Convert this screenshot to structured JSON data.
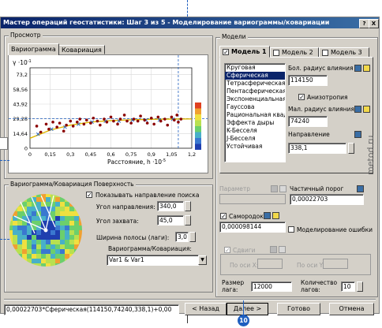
{
  "window": {
    "title": "Мастер операций геостатистики: Шаг 3 из 5 - Моделирование вариограммы/ковариации",
    "help_label": "?",
    "close_label": "X"
  },
  "preview": {
    "group_label": "Просмотр",
    "tab_variogram": "Вариограмма",
    "tab_covariance": "Ковариация",
    "y_exp": "γ ·10",
    "y_exp_sup": "-1",
    "x_label": "Расстояние, h ·10",
    "x_label_sup": "-5"
  },
  "chart_data": {
    "type": "scatter",
    "y_ticks": [
      "73,2",
      "58,56",
      "43,92",
      "29,28",
      "14,64",
      "0"
    ],
    "x_ticks": [
      "0",
      "0,15",
      "0,3",
      "0,45",
      "0,6",
      "0,75",
      "0,9",
      "1,05",
      "1,2"
    ],
    "xlim": [
      0,
      1.2
    ],
    "ylim": [
      0,
      80
    ],
    "points": [
      [
        0.05,
        22
      ],
      [
        0.08,
        16
      ],
      [
        0.12,
        24
      ],
      [
        0.14,
        19
      ],
      [
        0.17,
        26
      ],
      [
        0.2,
        21
      ],
      [
        0.22,
        25
      ],
      [
        0.25,
        17
      ],
      [
        0.27,
        23
      ],
      [
        0.3,
        27
      ],
      [
        0.32,
        22
      ],
      [
        0.35,
        26
      ],
      [
        0.37,
        29
      ],
      [
        0.4,
        24
      ],
      [
        0.42,
        28
      ],
      [
        0.45,
        25
      ],
      [
        0.47,
        30
      ],
      [
        0.5,
        27
      ],
      [
        0.52,
        23
      ],
      [
        0.55,
        29
      ],
      [
        0.57,
        26
      ],
      [
        0.6,
        31
      ],
      [
        0.62,
        27
      ],
      [
        0.65,
        24
      ],
      [
        0.67,
        29
      ],
      [
        0.7,
        33
      ],
      [
        0.72,
        27
      ],
      [
        0.75,
        25
      ],
      [
        0.77,
        29
      ],
      [
        0.8,
        27
      ],
      [
        0.82,
        32
      ],
      [
        0.85,
        28
      ],
      [
        0.87,
        25
      ],
      [
        0.9,
        30
      ],
      [
        0.92,
        24
      ],
      [
        0.95,
        31
      ],
      [
        0.97,
        27
      ],
      [
        1.0,
        29
      ],
      [
        1.02,
        23
      ],
      [
        1.05,
        31
      ],
      [
        1.07,
        28
      ],
      [
        1.09,
        33
      ],
      [
        1.1,
        26
      ],
      [
        1.12,
        29
      ]
    ],
    "crosses": [
      [
        0.06,
        14
      ],
      [
        0.16,
        19
      ],
      [
        0.26,
        21
      ],
      [
        0.36,
        24
      ],
      [
        0.46,
        26
      ],
      [
        0.56,
        27
      ],
      [
        0.66,
        27
      ],
      [
        0.76,
        28
      ],
      [
        0.86,
        28
      ],
      [
        0.96,
        28
      ],
      [
        1.06,
        29
      ]
    ],
    "model_curve": [
      [
        0,
        10
      ],
      [
        0.15,
        18
      ],
      [
        0.3,
        23
      ],
      [
        0.45,
        26
      ],
      [
        0.6,
        27.5
      ],
      [
        0.75,
        28.3
      ],
      [
        0.9,
        28.8
      ],
      [
        1.05,
        29
      ],
      [
        1.2,
        29.2
      ]
    ],
    "dash_h_value": 29.5,
    "dash_v_value": 1.1
  },
  "surface": {
    "group_label": "Вариограмма/Ковариация Поверхность",
    "show_direction_label": "Показывать направление поиска",
    "show_direction_checked": true,
    "angle_dir_label": "Угол направления:",
    "angle_dir_value": "340,0",
    "angle_capture_label": "Угол захвата:",
    "angle_capture_value": "45,0",
    "bandwidth_label": "Ширина полосы (лаги):",
    "bandwidth_value": "3,0",
    "variogram_select_label": "Вариограмма/Ковариация:",
    "variogram_select_value": "Var1 & Var1"
  },
  "models": {
    "group_label": "Модели",
    "tab1": "Модель 1",
    "tab2": "Модель 2",
    "tab3": "Модель 3",
    "model_list": [
      "Круговая",
      "Сферическая",
      "Тетрасферическая",
      "Пентасферическая",
      "Экспоненциальная",
      "Гауссова",
      "Рациональная квадратичная",
      "Эффекта дыры",
      "K-Бесселя",
      "J-Бесселя",
      "Устойчивая"
    ],
    "selected_index": 1,
    "major_range_label": "Бол. радиус влияния",
    "major_range_value": "114150",
    "anisotropy_label": "Анизотропия",
    "anisotropy_checked": true,
    "minor_range_label": "Мал. радиус влияния",
    "minor_range_value": "74240",
    "direction_label": "Направление",
    "direction_value": "338,1",
    "parameter_label": "Параметр",
    "partial_sill_label": "Частичный порог",
    "partial_sill_value": "0,00022703"
  },
  "nugget": {
    "label": "Самородок",
    "checked": true,
    "value": "0,000098144",
    "error_model_label": "Моделирование ошибки",
    "shift_label": "Сдвиги",
    "shift_x_label": "По оси X:",
    "shift_y_label": "По оси Y:"
  },
  "lag": {
    "size_label": "Размер лага:",
    "size_value": "12000",
    "count_label": "Количество лагов:",
    "count_value": "10"
  },
  "footer": {
    "formula": "0,00022703*Сферическая(114150,74240,338,1)+0,00",
    "back_label": "< Назад",
    "next_label": "Далее >",
    "finish_label": "Готово",
    "cancel_label": "Отмена"
  },
  "callout": {
    "number": "10"
  },
  "watermark": "metod.ru",
  "colors": {
    "title_start": "#0a246a",
    "title_end": "#3a6ea5",
    "callout_blue": "#1f5fbf",
    "select_blue": "#0a246a"
  }
}
